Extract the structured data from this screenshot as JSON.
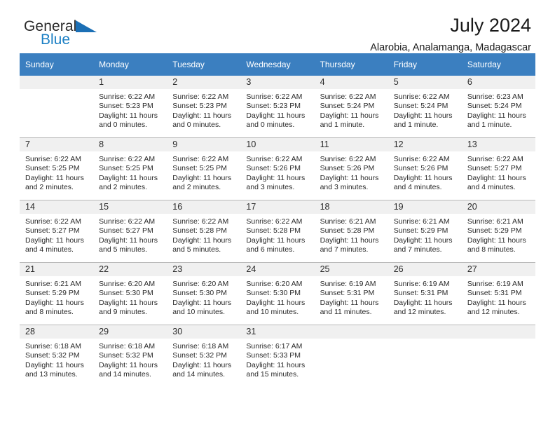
{
  "brand": {
    "name_part1": "General",
    "name_part2": "Blue",
    "triangle_color": "#1b6fb5",
    "blue_color": "#1b7fc4"
  },
  "header": {
    "title": "July 2024",
    "subtitle": "Alarobia, Analamanga, Madagascar",
    "header_bg_color": "#3b7fc0",
    "daynum_band_color": "#f0f0f0"
  },
  "weekday_headers": [
    "Sunday",
    "Monday",
    "Tuesday",
    "Wednesday",
    "Thursday",
    "Friday",
    "Saturday"
  ],
  "weeks": [
    [
      {
        "day": "",
        "sunrise": "",
        "sunset": "",
        "daylight_line1": "",
        "daylight_line2": ""
      },
      {
        "day": "1",
        "sunrise": "Sunrise: 6:22 AM",
        "sunset": "Sunset: 5:23 PM",
        "daylight_line1": "Daylight: 11 hours",
        "daylight_line2": "and 0 minutes."
      },
      {
        "day": "2",
        "sunrise": "Sunrise: 6:22 AM",
        "sunset": "Sunset: 5:23 PM",
        "daylight_line1": "Daylight: 11 hours",
        "daylight_line2": "and 0 minutes."
      },
      {
        "day": "3",
        "sunrise": "Sunrise: 6:22 AM",
        "sunset": "Sunset: 5:23 PM",
        "daylight_line1": "Daylight: 11 hours",
        "daylight_line2": "and 0 minutes."
      },
      {
        "day": "4",
        "sunrise": "Sunrise: 6:22 AM",
        "sunset": "Sunset: 5:24 PM",
        "daylight_line1": "Daylight: 11 hours",
        "daylight_line2": "and 1 minute."
      },
      {
        "day": "5",
        "sunrise": "Sunrise: 6:22 AM",
        "sunset": "Sunset: 5:24 PM",
        "daylight_line1": "Daylight: 11 hours",
        "daylight_line2": "and 1 minute."
      },
      {
        "day": "6",
        "sunrise": "Sunrise: 6:23 AM",
        "sunset": "Sunset: 5:24 PM",
        "daylight_line1": "Daylight: 11 hours",
        "daylight_line2": "and 1 minute."
      }
    ],
    [
      {
        "day": "7",
        "sunrise": "Sunrise: 6:22 AM",
        "sunset": "Sunset: 5:25 PM",
        "daylight_line1": "Daylight: 11 hours",
        "daylight_line2": "and 2 minutes."
      },
      {
        "day": "8",
        "sunrise": "Sunrise: 6:22 AM",
        "sunset": "Sunset: 5:25 PM",
        "daylight_line1": "Daylight: 11 hours",
        "daylight_line2": "and 2 minutes."
      },
      {
        "day": "9",
        "sunrise": "Sunrise: 6:22 AM",
        "sunset": "Sunset: 5:25 PM",
        "daylight_line1": "Daylight: 11 hours",
        "daylight_line2": "and 2 minutes."
      },
      {
        "day": "10",
        "sunrise": "Sunrise: 6:22 AM",
        "sunset": "Sunset: 5:26 PM",
        "daylight_line1": "Daylight: 11 hours",
        "daylight_line2": "and 3 minutes."
      },
      {
        "day": "11",
        "sunrise": "Sunrise: 6:22 AM",
        "sunset": "Sunset: 5:26 PM",
        "daylight_line1": "Daylight: 11 hours",
        "daylight_line2": "and 3 minutes."
      },
      {
        "day": "12",
        "sunrise": "Sunrise: 6:22 AM",
        "sunset": "Sunset: 5:26 PM",
        "daylight_line1": "Daylight: 11 hours",
        "daylight_line2": "and 4 minutes."
      },
      {
        "day": "13",
        "sunrise": "Sunrise: 6:22 AM",
        "sunset": "Sunset: 5:27 PM",
        "daylight_line1": "Daylight: 11 hours",
        "daylight_line2": "and 4 minutes."
      }
    ],
    [
      {
        "day": "14",
        "sunrise": "Sunrise: 6:22 AM",
        "sunset": "Sunset: 5:27 PM",
        "daylight_line1": "Daylight: 11 hours",
        "daylight_line2": "and 4 minutes."
      },
      {
        "day": "15",
        "sunrise": "Sunrise: 6:22 AM",
        "sunset": "Sunset: 5:27 PM",
        "daylight_line1": "Daylight: 11 hours",
        "daylight_line2": "and 5 minutes."
      },
      {
        "day": "16",
        "sunrise": "Sunrise: 6:22 AM",
        "sunset": "Sunset: 5:28 PM",
        "daylight_line1": "Daylight: 11 hours",
        "daylight_line2": "and 5 minutes."
      },
      {
        "day": "17",
        "sunrise": "Sunrise: 6:22 AM",
        "sunset": "Sunset: 5:28 PM",
        "daylight_line1": "Daylight: 11 hours",
        "daylight_line2": "and 6 minutes."
      },
      {
        "day": "18",
        "sunrise": "Sunrise: 6:21 AM",
        "sunset": "Sunset: 5:28 PM",
        "daylight_line1": "Daylight: 11 hours",
        "daylight_line2": "and 7 minutes."
      },
      {
        "day": "19",
        "sunrise": "Sunrise: 6:21 AM",
        "sunset": "Sunset: 5:29 PM",
        "daylight_line1": "Daylight: 11 hours",
        "daylight_line2": "and 7 minutes."
      },
      {
        "day": "20",
        "sunrise": "Sunrise: 6:21 AM",
        "sunset": "Sunset: 5:29 PM",
        "daylight_line1": "Daylight: 11 hours",
        "daylight_line2": "and 8 minutes."
      }
    ],
    [
      {
        "day": "21",
        "sunrise": "Sunrise: 6:21 AM",
        "sunset": "Sunset: 5:29 PM",
        "daylight_line1": "Daylight: 11 hours",
        "daylight_line2": "and 8 minutes."
      },
      {
        "day": "22",
        "sunrise": "Sunrise: 6:20 AM",
        "sunset": "Sunset: 5:30 PM",
        "daylight_line1": "Daylight: 11 hours",
        "daylight_line2": "and 9 minutes."
      },
      {
        "day": "23",
        "sunrise": "Sunrise: 6:20 AM",
        "sunset": "Sunset: 5:30 PM",
        "daylight_line1": "Daylight: 11 hours",
        "daylight_line2": "and 10 minutes."
      },
      {
        "day": "24",
        "sunrise": "Sunrise: 6:20 AM",
        "sunset": "Sunset: 5:30 PM",
        "daylight_line1": "Daylight: 11 hours",
        "daylight_line2": "and 10 minutes."
      },
      {
        "day": "25",
        "sunrise": "Sunrise: 6:19 AM",
        "sunset": "Sunset: 5:31 PM",
        "daylight_line1": "Daylight: 11 hours",
        "daylight_line2": "and 11 minutes."
      },
      {
        "day": "26",
        "sunrise": "Sunrise: 6:19 AM",
        "sunset": "Sunset: 5:31 PM",
        "daylight_line1": "Daylight: 11 hours",
        "daylight_line2": "and 12 minutes."
      },
      {
        "day": "27",
        "sunrise": "Sunrise: 6:19 AM",
        "sunset": "Sunset: 5:31 PM",
        "daylight_line1": "Daylight: 11 hours",
        "daylight_line2": "and 12 minutes."
      }
    ],
    [
      {
        "day": "28",
        "sunrise": "Sunrise: 6:18 AM",
        "sunset": "Sunset: 5:32 PM",
        "daylight_line1": "Daylight: 11 hours",
        "daylight_line2": "and 13 minutes."
      },
      {
        "day": "29",
        "sunrise": "Sunrise: 6:18 AM",
        "sunset": "Sunset: 5:32 PM",
        "daylight_line1": "Daylight: 11 hours",
        "daylight_line2": "and 14 minutes."
      },
      {
        "day": "30",
        "sunrise": "Sunrise: 6:18 AM",
        "sunset": "Sunset: 5:32 PM",
        "daylight_line1": "Daylight: 11 hours",
        "daylight_line2": "and 14 minutes."
      },
      {
        "day": "31",
        "sunrise": "Sunrise: 6:17 AM",
        "sunset": "Sunset: 5:33 PM",
        "daylight_line1": "Daylight: 11 hours",
        "daylight_line2": "and 15 minutes."
      },
      {
        "day": "",
        "sunrise": "",
        "sunset": "",
        "daylight_line1": "",
        "daylight_line2": ""
      },
      {
        "day": "",
        "sunrise": "",
        "sunset": "",
        "daylight_line1": "",
        "daylight_line2": ""
      },
      {
        "day": "",
        "sunrise": "",
        "sunset": "",
        "daylight_line1": "",
        "daylight_line2": ""
      }
    ]
  ]
}
